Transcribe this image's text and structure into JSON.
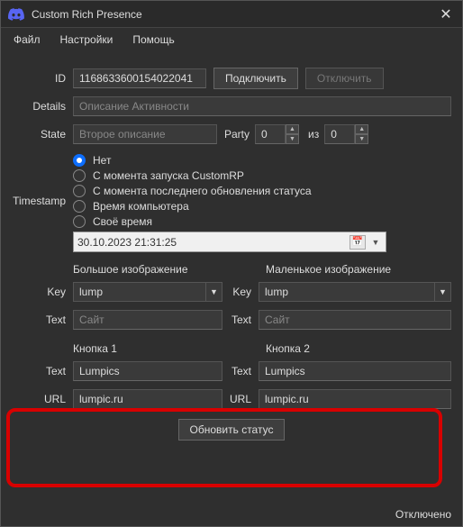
{
  "title": "Custom Rich Presence",
  "menu": {
    "file": "Файл",
    "settings": "Настройки",
    "help": "Помощь"
  },
  "labels": {
    "id": "ID",
    "details": "Details",
    "state": "State",
    "party": "Party",
    "of": "из",
    "timestamp": "Timestamp",
    "key": "Key",
    "text": "Text",
    "url": "URL"
  },
  "fields": {
    "id": "1168633600154022041",
    "details_placeholder": "Описание Активности",
    "state_placeholder": "Второе описание",
    "party_cur": "0",
    "party_max": "0",
    "datetime": "30.10.2023 21:31:25"
  },
  "buttons": {
    "connect": "Подключить",
    "disconnect": "Отключить",
    "update": "Обновить статус"
  },
  "radios": {
    "none": "Нет",
    "since_launch": "С момента запуска CustomRP",
    "since_update": "С момента последнего обновления статуса",
    "pc_time": "Время компьютера",
    "custom": "Своё время"
  },
  "image": {
    "big_header": "Большое изображение",
    "small_header": "Маленькое изображение",
    "key_val": "lump",
    "text_placeholder": "Сайт"
  },
  "btns": {
    "h1": "Кнопка 1",
    "h2": "Кнопка 2",
    "text_val": "Lumpics",
    "url_val": "lumpic.ru"
  },
  "status": "Отключено"
}
